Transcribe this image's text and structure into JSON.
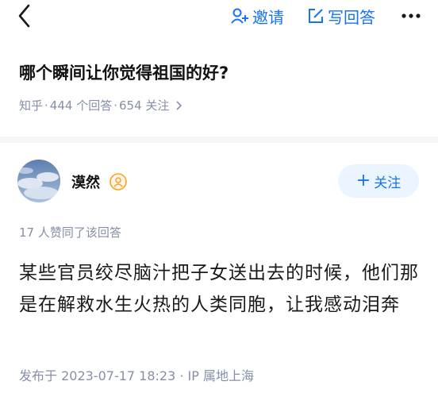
{
  "topbar": {
    "back_icon": "chevron-left-icon",
    "invite_label": "邀请",
    "write_label": "写回答",
    "more_icon": "more-dots-icon",
    "accent": "#1772f6"
  },
  "question": {
    "title": "哪个瞬间让你觉得祖国的好?",
    "source": "知乎",
    "answers": "444 个回答",
    "followers": "654 关注",
    "separator": "·"
  },
  "answer": {
    "author": "漠然",
    "follow_label": "关注",
    "likes": "17 人赞同了该回答",
    "content": "某些官员绞尽脑汁把子女送出去的时候，他们那是在解救水生火热的人类同胞，让我感动泪奔",
    "footer": "发布于 2023-07-17 18:23 · IP 属地上海"
  }
}
